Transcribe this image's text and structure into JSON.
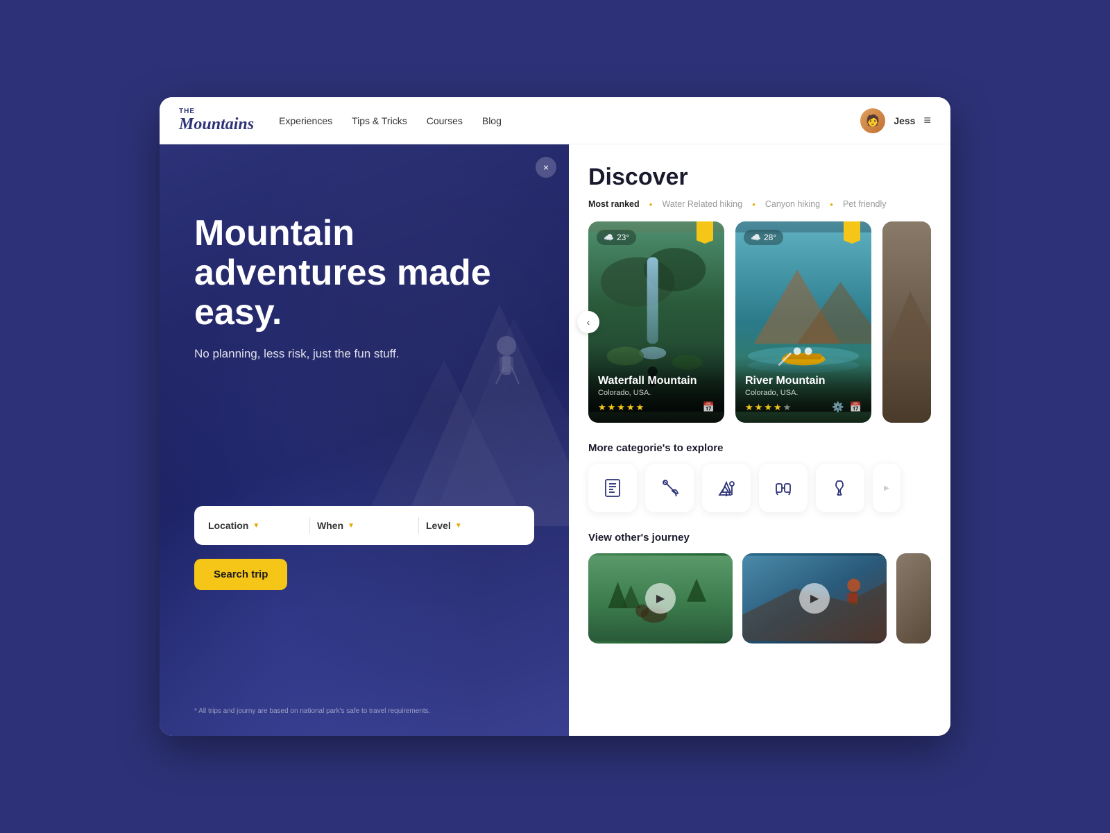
{
  "app": {
    "title": "The Mountains"
  },
  "navbar": {
    "logo": "Mountains",
    "logo_the": "THE",
    "links": [
      {
        "label": "Experiences",
        "id": "experiences"
      },
      {
        "label": "Tips & Tricks",
        "id": "tips-tricks"
      },
      {
        "label": "Courses",
        "id": "courses"
      },
      {
        "label": "Blog",
        "id": "blog"
      }
    ],
    "user": {
      "name": "Jess"
    },
    "menu_icon": "≡"
  },
  "hero": {
    "title": "Mountain adventures made easy.",
    "subtitle": "No planning, less risk, just the fun stuff.",
    "close_label": "×",
    "disclaimer": "* All trips and journy are based on national park's safe to travel requirements."
  },
  "search": {
    "location_label": "Location",
    "when_label": "When",
    "level_label": "Level",
    "button_label": "Search trip"
  },
  "discover": {
    "title": "Discover",
    "filters": [
      {
        "label": "Most ranked",
        "active": true
      },
      {
        "label": "Water Related hiking",
        "active": false
      },
      {
        "label": "Canyon hiking",
        "active": false
      },
      {
        "label": "Pet friendly",
        "active": false
      }
    ]
  },
  "cards": [
    {
      "title": "Waterfall Mountain",
      "location": "Colorado, USA.",
      "temp": "23°",
      "rating": 4.5,
      "id": "waterfall"
    },
    {
      "title": "River Mountain",
      "location": "Colorado, USA.",
      "temp": "28°",
      "rating": 4.0,
      "id": "river"
    }
  ],
  "categories": {
    "title": "More categorie's to explore",
    "items": [
      {
        "label": "Checklist",
        "icon": "📋"
      },
      {
        "label": "Fishing",
        "icon": "🎣"
      },
      {
        "label": "Hiking",
        "icon": "⛰️"
      },
      {
        "label": "Gear",
        "icon": "👜"
      },
      {
        "label": "Rope",
        "icon": "🧶"
      }
    ]
  },
  "journeys": {
    "title": "View other's journey",
    "items": [
      {
        "label": "Meadow journey",
        "id": "meadow"
      },
      {
        "label": "Adventure journey",
        "id": "adventure"
      }
    ]
  }
}
